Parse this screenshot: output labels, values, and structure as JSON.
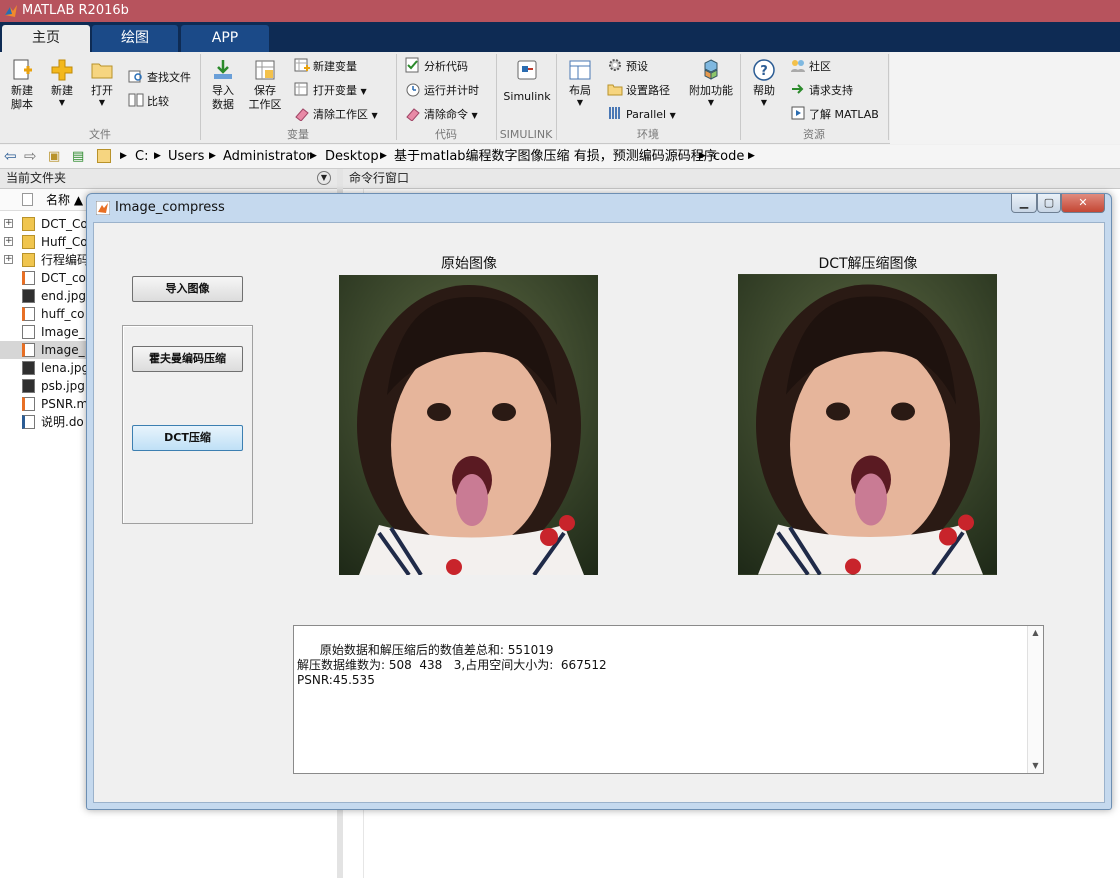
{
  "app": {
    "title": "MATLAB R2016b"
  },
  "tabs": [
    {
      "label": "主页",
      "active": true
    },
    {
      "label": "绘图",
      "active": false
    },
    {
      "label": "APP",
      "active": false
    }
  ],
  "ribbon": {
    "file": {
      "new_script": "新建\n脚本",
      "new": "新建",
      "open": "打开",
      "find_files": "查找文件",
      "compare": "比较",
      "group": "文件"
    },
    "variable": {
      "import": "导入\n数据",
      "save_ws": "保存\n工作区",
      "new_var": "新建变量",
      "open_var": "打开变量",
      "clear_ws": "清除工作区",
      "group": "变量"
    },
    "code": {
      "analyze": "分析代码",
      "run_time": "运行并计时",
      "clear_cmds": "清除命令",
      "group": "代码"
    },
    "simulink": {
      "label": "Simulink",
      "group": "SIMULINK"
    },
    "environment": {
      "layout": "布局",
      "prefs": "预设",
      "set_path": "设置路径",
      "parallel": "Parallel",
      "addons": "附加功能",
      "group": "环境"
    },
    "resources": {
      "help": "帮助",
      "community": "社区",
      "support": "请求支持",
      "learn": "了解 MATLAB",
      "group": "资源"
    }
  },
  "address": {
    "path": [
      "C:",
      "Users",
      "Administrator",
      "Desktop",
      "基于matlab编程数字图像压缩 有损，预测编码源码程序",
      "code"
    ]
  },
  "panes": {
    "current_folder": "当前文件夹",
    "command_window": "命令行窗口",
    "name_col": "名称 ▲"
  },
  "files": [
    {
      "name": "DCT_Co",
      "type": "folder",
      "expandable": true
    },
    {
      "name": "Huff_Co",
      "type": "folder",
      "expandable": true
    },
    {
      "name": "行程编码",
      "type": "folder",
      "expandable": true
    },
    {
      "name": "DCT_co",
      "type": "m"
    },
    {
      "name": "end.jpg",
      "type": "jpg"
    },
    {
      "name": "huff_co",
      "type": "m"
    },
    {
      "name": "Image_",
      "type": "fig"
    },
    {
      "name": "Image_",
      "type": "m",
      "selected": true
    },
    {
      "name": "lena.jpg",
      "type": "jpg"
    },
    {
      "name": "psb.jpg",
      "type": "jpg"
    },
    {
      "name": "PSNR.m",
      "type": "m"
    },
    {
      "name": "说明.do",
      "type": "doc"
    }
  ],
  "dialog": {
    "title": "Image_compress",
    "buttons": {
      "import": "导入图像",
      "huffman": "霍夫曼编码压缩",
      "dct": "DCT压缩"
    },
    "axes": {
      "original": "原始图像",
      "decompressed": "DCT解压缩图像"
    },
    "output": "原始数据和解压缩后的数值差总和: 551019\n解压数据维数为: 508  438   3,占用空间大小为:  667512\nPSNR:45.535"
  },
  "colors": {
    "title_bar": "#b7535d",
    "tab_bar": "#0e2b54",
    "window_frame": "#c5d9ee"
  }
}
